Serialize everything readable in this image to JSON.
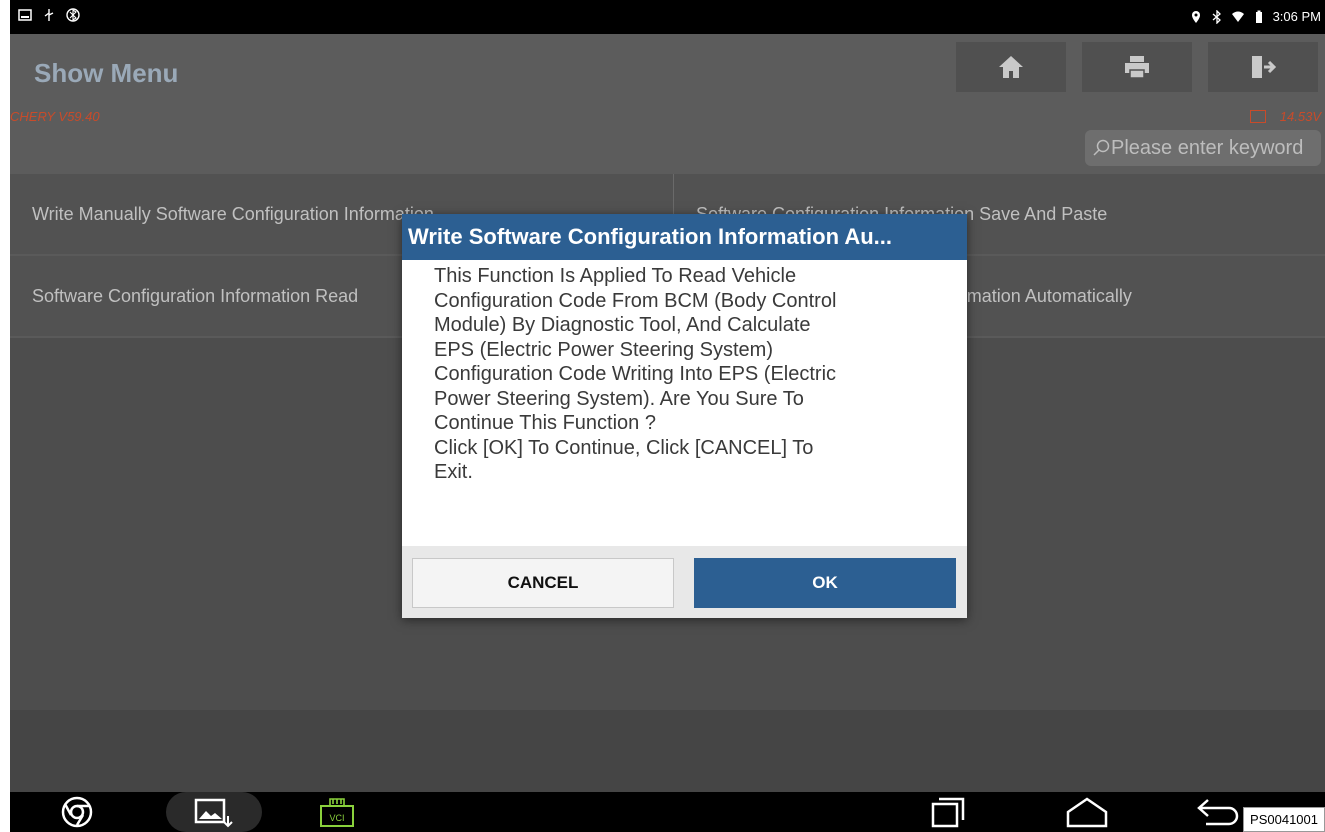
{
  "status_bar": {
    "time": "3:06 PM",
    "left_icons": [
      "screenshot-icon",
      "usb-icon",
      "bluetooth-status-icon"
    ],
    "right_icons": [
      "location-icon",
      "bluetooth-icon",
      "wifi-icon",
      "battery-icon"
    ]
  },
  "header": {
    "title": "Show Menu",
    "version": "CHERY V59.40",
    "voltage": "14.53V",
    "buttons": [
      "home-icon",
      "print-icon",
      "exit-icon"
    ],
    "search_placeholder": "Please enter keyword"
  },
  "menu": {
    "rows": [
      {
        "left": "Write Manually Software Configuration Information",
        "right": "Software Configuration Information Save And Paste"
      },
      {
        "left": "Software Configuration Information Read",
        "right": "Write Software Configuration Information Automatically"
      }
    ]
  },
  "dialog": {
    "title": "Write Software Configuration Information Au...",
    "message": "This Function Is Applied To Read Vehicle\nConfiguration Code From BCM (Body Control\nModule) By Diagnostic Tool, And Calculate\nEPS (Electric Power Steering System)\nConfiguration Code Writing Into EPS (Electric\nPower Steering System). Are You Sure To\nContinue This Function ?\nClick [OK] To Continue, Click [CANCEL] To\nExit.",
    "cancel_label": "CANCEL",
    "ok_label": "OK"
  },
  "navbar": {
    "vci_label": "VCI",
    "icons": [
      "browser-icon",
      "gallery-icon",
      "vci-icon",
      "recent-apps-icon",
      "home-nav-icon",
      "back-icon"
    ]
  },
  "code": "PS0041001"
}
